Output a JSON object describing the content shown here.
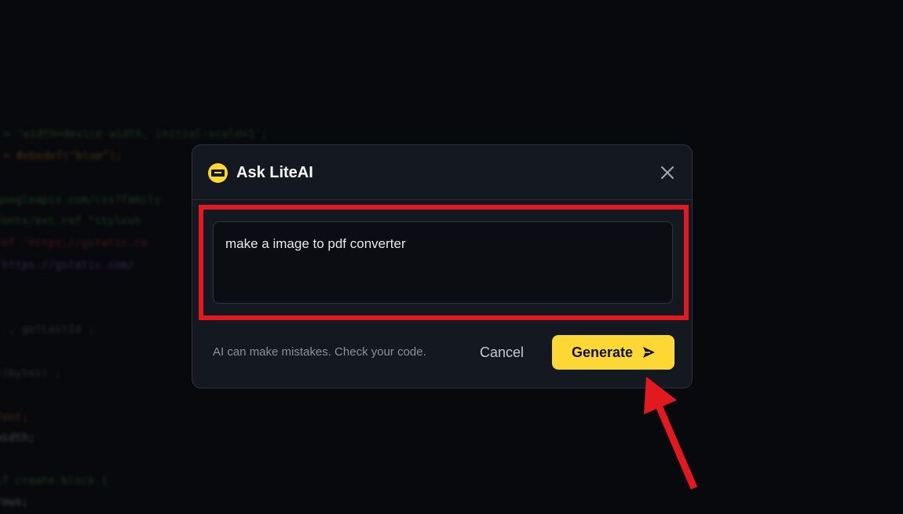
{
  "background_code": [
    {
      "text": "= 'width=device-width, initial-scale=1';",
      "cls": "c-green"
    },
    {
      "text": "= #ebedef(\"blue\");",
      "cls": "c-orange"
    },
    {
      "text": "googleapis.com/css?family",
      "cls": "c-green"
    },
    {
      "text": "fonts/ext.ref \"stylesh",
      "cls": "c-green"
    },
    {
      "text": "ref 'https://gstatic.co",
      "cls": "c-red"
    },
    {
      "text": "'https://gstatic.com/",
      "cls": "c-purple"
    },
    {
      "text": "' , getLastId ;",
      "cls": "c-gray"
    },
    {
      "text": "t(bytes) ;",
      "cls": "c-gray"
    },
    {
      "text": "font;",
      "cls": "c-orange"
    },
    {
      "text": "width;",
      "cls": "c-white"
    },
    {
      "text": "if create-block {",
      "cls": "c-green"
    },
    {
      "text": "rows;",
      "cls": "c-white"
    }
  ],
  "modal": {
    "title": "Ask LiteAI",
    "logo_icon": "liteai-logo-icon",
    "close_icon": "close-icon",
    "prompt_value": "make a image to pdf converter",
    "disclaimer": "AI can make mistakes. Check your code.",
    "cancel_label": "Cancel",
    "generate_label": "Generate",
    "generate_icon": "send-icon"
  },
  "colors": {
    "accent": "#fdd835",
    "modal_bg": "#141820",
    "annotation": "#e2191e"
  },
  "annotations": {
    "highlight": "prompt-field",
    "arrow_target": "generate-button"
  }
}
